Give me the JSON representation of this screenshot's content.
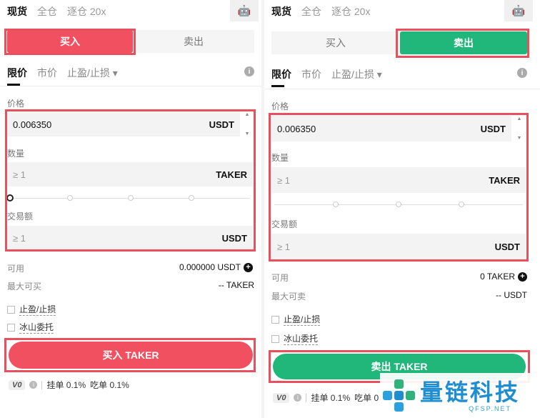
{
  "left": {
    "top_tabs": [
      "现货",
      "全仓",
      "逐仓 20x"
    ],
    "side_tabs": {
      "buy": "买入",
      "sell": "卖出"
    },
    "order_tabs": {
      "limit": "限价",
      "market": "市价",
      "stop": "止盈/止损"
    },
    "price_label": "价格",
    "price_value": "0.006350",
    "price_unit": "USDT",
    "qty_label": "数量",
    "qty_placeholder": "≥ 1",
    "qty_unit": "TAKER",
    "amount_label": "交易额",
    "amount_placeholder": "≥ 1",
    "amount_unit": "USDT",
    "available_label": "可用",
    "available_value": "0.000000 USDT",
    "max_label": "最大可买",
    "max_value": "-- TAKER",
    "tp_sl_label": "止盈/止损",
    "iceberg_label": "冰山委托",
    "submit_label": "买入 TAKER",
    "vip_level": "V0",
    "maker_fee": "挂单 0.1%",
    "taker_fee": "吃单 0.1%"
  },
  "right": {
    "top_tabs": [
      "现货",
      "全仓",
      "逐仓 20x"
    ],
    "side_tabs": {
      "buy": "买入",
      "sell": "卖出"
    },
    "order_tabs": {
      "limit": "限价",
      "market": "市价",
      "stop": "止盈/止损"
    },
    "price_label": "价格",
    "price_value": "0.006350",
    "price_unit": "USDT",
    "qty_label": "数量",
    "qty_placeholder": "≥ 1",
    "qty_unit": "TAKER",
    "amount_label": "交易额",
    "amount_placeholder": "≥ 1",
    "amount_unit": "USDT",
    "available_label": "可用",
    "available_value": "0 TAKER",
    "max_label": "最大可卖",
    "max_value": "-- USDT",
    "tp_sl_label": "止盈/止损",
    "iceberg_label": "冰山委托",
    "submit_label": "卖出 TAKER",
    "vip_level": "V0",
    "maker_fee": "挂单 0.1%",
    "taker_fee": "吃单 0"
  },
  "watermark": {
    "main": "量链科技",
    "sub": "QFSP.NET"
  },
  "colors": {
    "buy": "#f0505f",
    "sell": "#21b67a",
    "highlight": "#e8505d"
  },
  "icons": [
    "robot-icon",
    "info-icon",
    "caret-down-icon",
    "plus-circle-icon",
    "stepper-up-icon",
    "stepper-down-icon"
  ]
}
